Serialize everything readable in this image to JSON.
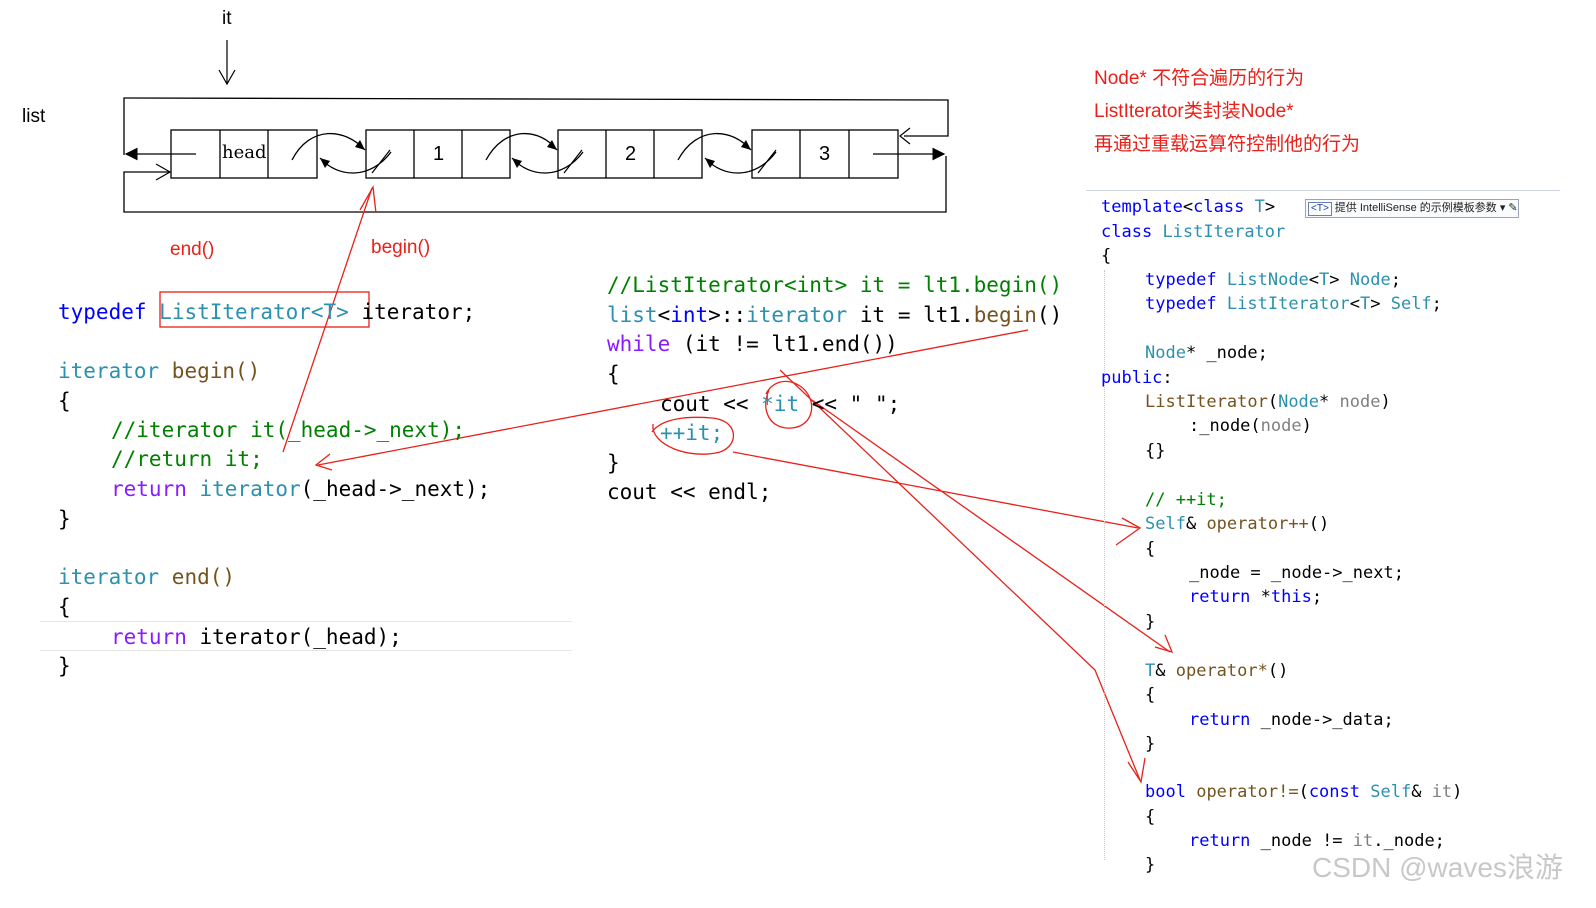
{
  "list_diagram": {
    "it_label": "it",
    "list_label": "list",
    "nodes": [
      "head",
      "1",
      "2",
      "3"
    ],
    "end_label": "end()",
    "begin_label": "begin()"
  },
  "notes": [
    "Node* 不符合遍历的行为",
    "ListIterator类封装Node*",
    "再通过重载运算符控制他的行为"
  ],
  "left_code": {
    "typedef_kw": "typedef",
    "typedef_type": "ListIterator<T>",
    "typedef_name": " iterator;",
    "begin_sig_type": "iterator",
    "begin_sig_fn": " begin()",
    "brace_open": "{",
    "comment1": "//iterator it(_head->_next);",
    "comment2": "//return it;",
    "return_kw": "return",
    "return_type": " iterator",
    "return_args": "(_head->_next);",
    "brace_close": "}",
    "end_sig_type": "iterator",
    "end_sig_fn": " end()",
    "end_return_kw": "return",
    "end_return_rest": " iterator(_head);"
  },
  "mid_code": {
    "comment": "//ListIterator<int> it = lt1.begin()",
    "line2": "list<int>::iterator it = lt1.begin()",
    "while_kw": "while",
    "while_rest": " (it != lt1.end())",
    "brace_open": "{",
    "cout_line_a": "cout << ",
    "cout_deref": "*it",
    "cout_line_b": " << \" \";",
    "incr": "++it;",
    "brace_close": "}",
    "cout_endl": "cout << endl;"
  },
  "right_code": {
    "l1": "template<class T>",
    "l2": "class ListIterator",
    "l3": "{",
    "l4": "typedef ListNode<T> Node;",
    "l5": "typedef ListIterator<T> Self;",
    "l6": "Node* _node;",
    "l7": "public:",
    "l8": "ListIterator(Node* node)",
    "l9": ":_node(node)",
    "l10": "{}",
    "l11": "// ++it;",
    "l12": "Self& operator++()",
    "l13": "{",
    "l14": "_node = _node->_next;",
    "l15": "return *this;",
    "l16": "}",
    "l17": "T& operator*()",
    "l18": "{",
    "l19": "return _node->_data;",
    "l20": "}",
    "l21": "bool operator!=(const Self& it)",
    "l22": "{",
    "l23": "return _node != it._node;",
    "l24": "}"
  },
  "hint": {
    "tag": "<T>",
    "text": "提供 IntelliSense 的示例模板参数"
  },
  "watermark": "CSDN @waves浪游",
  "colors": {
    "annotation": "#e8211a",
    "keyword": "#0000ff",
    "type": "#2b91af",
    "comment": "#008000"
  }
}
